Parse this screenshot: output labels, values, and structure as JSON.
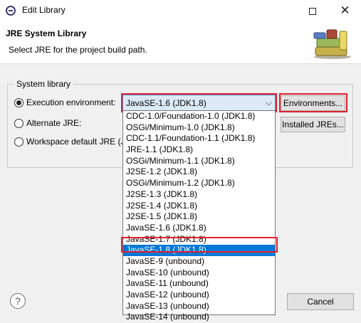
{
  "window": {
    "title": "Edit Library",
    "maximize_icon": "maximize-icon",
    "close_symbol": "✕"
  },
  "header": {
    "title": "JRE System Library",
    "description": "Select JRE for the project build path."
  },
  "group": {
    "label": "System library",
    "options": [
      {
        "label": "Execution environment:",
        "checked": true
      },
      {
        "label": "Alternate JRE:",
        "checked": false
      },
      {
        "label": "Workspace default JRE (JD",
        "checked": false
      }
    ]
  },
  "combo": {
    "value": "JavaSE-1.6 (JDK1.8)",
    "chevron": "⌵"
  },
  "buttons": {
    "environments": "Environments...",
    "installed_jres": "Installed JREs...",
    "cancel": "Cancel"
  },
  "dropdown": {
    "selected_index": 14,
    "items": [
      "CDC-1.0/Foundation-1.0 (JDK1.8)",
      "OSGi/Minimum-1.0 (JDK1.8)",
      "CDC-1.1/Foundation-1.1 (JDK1.8)",
      "JRE-1.1 (JDK1.8)",
      "OSGi/Minimum-1.1 (JDK1.8)",
      "J2SE-1.2 (JDK1.8)",
      "OSGi/Minimum-1.2 (JDK1.8)",
      "J2SE-1.3 (JDK1.8)",
      "J2SE-1.4 (JDK1.8)",
      "J2SE-1.5 (JDK1.8)",
      "JavaSE-1.6 (JDK1.8)",
      "JavaSE-1.7 (JDK1.8)",
      "JavaSE-1.8 (JDK1.8)",
      "JavaSE-9 (unbound)",
      "JavaSE-10 (unbound)",
      "JavaSE-11 (unbound)",
      "JavaSE-12 (unbound)",
      "JavaSE-13 (unbound)",
      "JavaSE-14 (unbound)"
    ]
  },
  "help": {
    "symbol": "?"
  },
  "colors": {
    "highlight": "#e0202c",
    "selection": "#0078d7",
    "combo_bg": "#dce9f7"
  }
}
